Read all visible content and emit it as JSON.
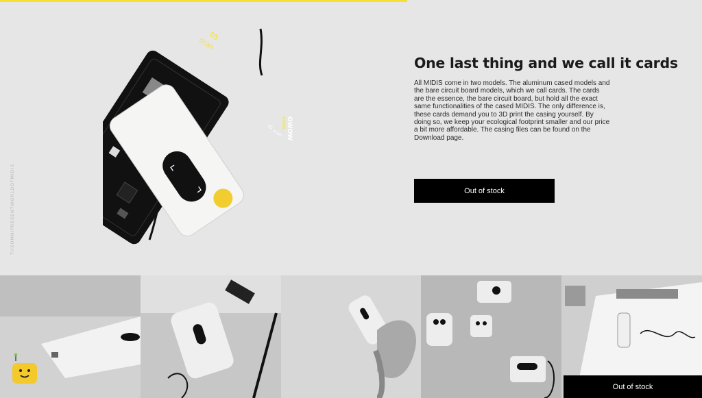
{
  "progress": {
    "percent": 58
  },
  "side_credit": "THEOMNIPRESENTWORLDOFMIDIS",
  "card_art": {
    "number": "05",
    "mode": "scan",
    "brand": "OWOW",
    "product": "midis",
    "silk_number": "05",
    "silk_mode": "scan"
  },
  "headline": "One last thing and we call it cards",
  "body": "All MIDIS come in two models. The aluminum cased models and the bare circuit board models, which we call cards. The cards are the essence, the bare circuit board, but hold all the exact same functionalities of the cased MIDIS. The only difference is, these cards demand you to 3D print the casing yourself. By doing so, we keep your ecological footprint smaller and our price a bit more affordable. The casing files can be found on the Download page.",
  "cta_label": "Out of stock",
  "gallery": {
    "photos": [
      "midi-device-close-up",
      "midi-remote-with-pen",
      "midi-held-in-hand",
      "midi-devices-on-table",
      "midi-on-workbench"
    ],
    "badge_label": "Out of stock"
  },
  "colors": {
    "accent": "#f7e034",
    "background": "#e6e6e6",
    "button": "#000000"
  },
  "icons": {
    "chat": "robot-face-icon"
  }
}
